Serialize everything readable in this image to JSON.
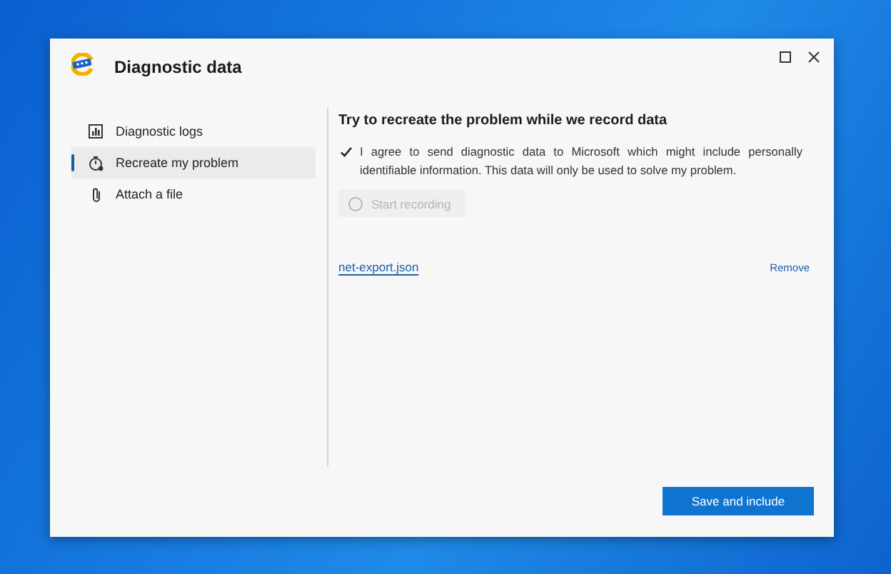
{
  "window": {
    "title": "Diagnostic data"
  },
  "sidebar": {
    "items": [
      {
        "label": "Diagnostic logs",
        "kind": "logs",
        "selected": false
      },
      {
        "label": "Recreate my problem",
        "kind": "recreate",
        "selected": true
      },
      {
        "label": "Attach a file",
        "kind": "attach",
        "selected": false
      }
    ]
  },
  "content": {
    "heading": "Try to recreate the problem while we record data",
    "consent": {
      "text": "I agree to send diagnostic data to Microsoft which might include personally identifiable information. This data will only be used to solve my problem.",
      "checked": true
    },
    "record_button": {
      "label": "Start recording",
      "disabled": true
    },
    "file": {
      "name": "net-export.json",
      "remove": "Remove"
    }
  },
  "footer": {
    "primary_button": "Save and include"
  }
}
